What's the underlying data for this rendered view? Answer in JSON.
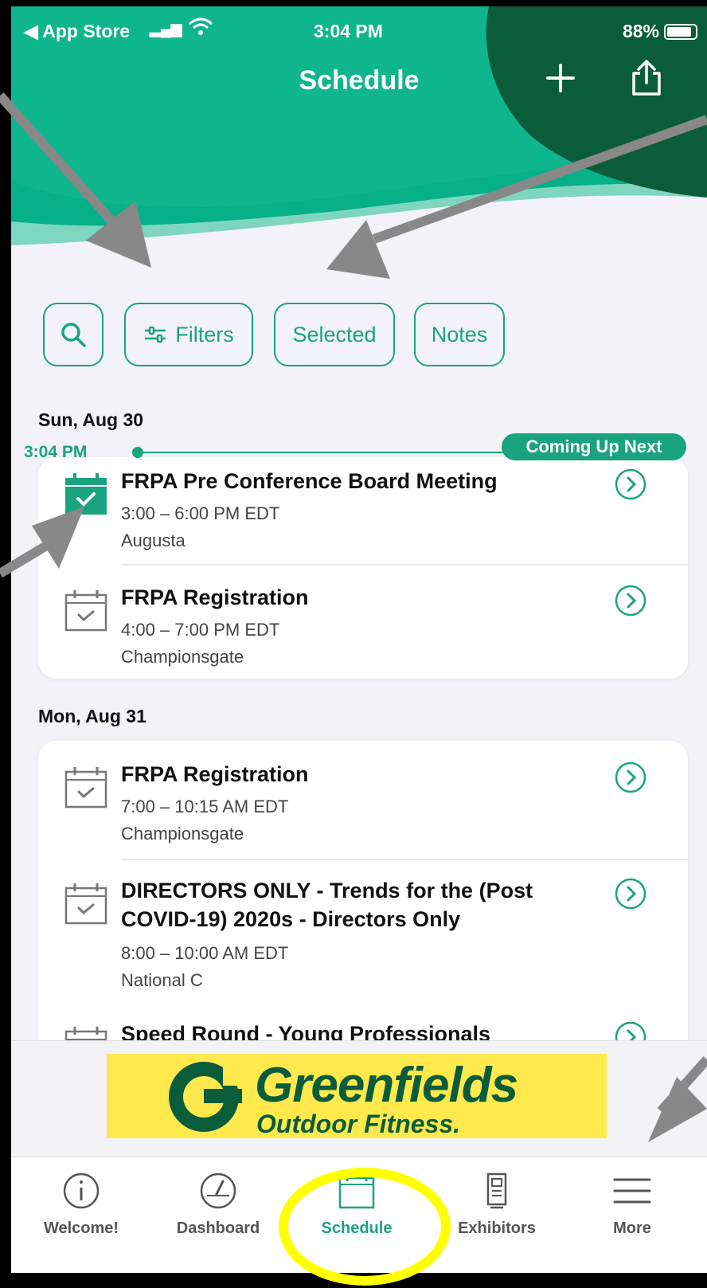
{
  "status_bar": {
    "back_app": "◀ App Store",
    "time": "3:04 PM",
    "battery": "88%"
  },
  "header": {
    "title": "Schedule",
    "add_icon": "plus-icon",
    "share_icon": "share-icon"
  },
  "filters": {
    "search_icon": "search-icon",
    "filters_label": "Filters",
    "selected_label": "Selected",
    "notes_label": "Notes"
  },
  "now": {
    "time": "3:04 PM",
    "tag": "Coming Up Next"
  },
  "days": [
    {
      "date": "Sun, Aug 30",
      "events": [
        {
          "title": "FRPA Pre Conference Board Meeting",
          "time": "3:00 – 6:00 PM EDT",
          "location": "Augusta",
          "selected": true
        },
        {
          "title": "FRPA Registration",
          "time": "4:00 – 7:00 PM EDT",
          "location": "Championsgate",
          "selected": false
        }
      ]
    },
    {
      "date": "Mon, Aug 31",
      "events": [
        {
          "title": "FRPA Registration",
          "time": "7:00 – 10:15 AM EDT",
          "location": "Championsgate",
          "selected": false
        },
        {
          "title": "DIRECTORS ONLY - Trends for the (Post COVID-19) 2020s - Directors Only",
          "time": "8:00 – 10:00 AM EDT",
          "location": "National C",
          "selected": false
        },
        {
          "title": "Speed Round - Young Professionals",
          "selected": false
        }
      ]
    }
  ],
  "ad": {
    "brand": "Greenfields",
    "tagline": "Outdoor Fitness."
  },
  "tabs": [
    {
      "label": "Welcome!",
      "icon": "info-icon"
    },
    {
      "label": "Dashboard",
      "icon": "gauge-icon"
    },
    {
      "label": "Schedule",
      "icon": "calendar-icon",
      "active": true
    },
    {
      "label": "Exhibitors",
      "icon": "booth-icon"
    },
    {
      "label": "More",
      "icon": "menu-icon"
    }
  ],
  "colors": {
    "accent": "#1aa37f",
    "header_light": "#06b089",
    "header_dark": "#0a5c3b",
    "highlight_circle": "#ffff00",
    "ad_bg": "#ffe94d"
  }
}
